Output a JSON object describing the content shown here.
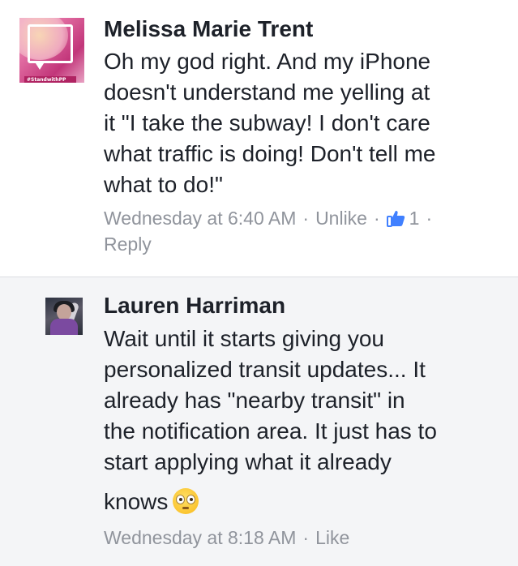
{
  "comments": [
    {
      "author": "Melissa Marie Trent",
      "avatar_badge": "#StandwithPP",
      "text_lines": [
        "Oh my god right. And my iPhone",
        "doesn't understand me yelling at",
        "it \"I take the subway! I don't care",
        "what traffic is doing! Don't tell me",
        "what to do!\""
      ],
      "timestamp": "Wednesday at 6:40 AM",
      "like_action": "Unlike",
      "like_icon": "thumbs-up-icon",
      "like_count": "1",
      "reply_action": "Reply",
      "separator": "·"
    },
    {
      "author": "Lauren Harriman",
      "text_lines": [
        "Wait until it starts giving you",
        "personalized  transit updates... It",
        "already has \"nearby transit\" in",
        "the notification area. It just has to",
        "start applying what it already"
      ],
      "last_line": "knows",
      "emoji": "flushed-face-emoji",
      "timestamp": "Wednesday at 8:18 AM",
      "like_action": "Like",
      "separator": "·"
    }
  ],
  "colors": {
    "text": "#1d2129",
    "meta": "#90949c",
    "like_blue": "#4080ff",
    "reply_bg": "#f4f5f7"
  }
}
